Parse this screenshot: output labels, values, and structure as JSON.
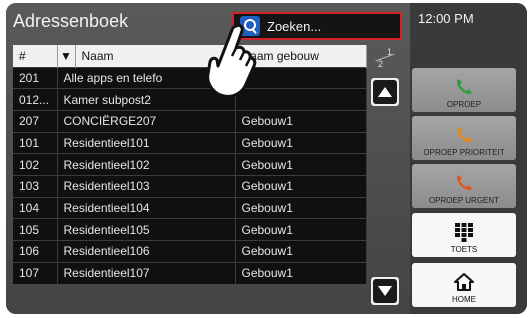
{
  "header": {
    "title": "Adressenboek",
    "time": "12:00 PM"
  },
  "search": {
    "placeholder": "Zoeken..."
  },
  "table": {
    "columns": {
      "num": "#",
      "name": "Naam",
      "building": "Naam gebouw"
    },
    "rows": [
      {
        "num": "201",
        "name": "Alle apps en telefo",
        "building": ""
      },
      {
        "num": "012...",
        "name": "Kamer subpost2",
        "building": ""
      },
      {
        "num": "207",
        "name": "CONCIËRGE207",
        "building": "Gebouw1"
      },
      {
        "num": "101",
        "name": "Residentieel101",
        "building": "Gebouw1"
      },
      {
        "num": "102",
        "name": "Residentieel102",
        "building": "Gebouw1"
      },
      {
        "num": "103",
        "name": "Residentieel103",
        "building": "Gebouw1"
      },
      {
        "num": "104",
        "name": "Residentieel104",
        "building": "Gebouw1"
      },
      {
        "num": "105",
        "name": "Residentieel105",
        "building": "Gebouw1"
      },
      {
        "num": "106",
        "name": "Residentieel106",
        "building": "Gebouw1"
      },
      {
        "num": "107",
        "name": "Residentieel107",
        "building": "Gebouw1"
      }
    ]
  },
  "pagination": {
    "current": "1",
    "total": "2"
  },
  "side_buttons": {
    "call": "OPROEP",
    "priority": "OPROEP PRIORITEIT",
    "urgent": "OPROEP URGENT",
    "keypad": "TOETS",
    "home": "HOME"
  },
  "colors": {
    "call": "#2e9e3a",
    "priority": "#e8891a",
    "urgent": "#e0561e",
    "search_border": "#d2232a"
  }
}
